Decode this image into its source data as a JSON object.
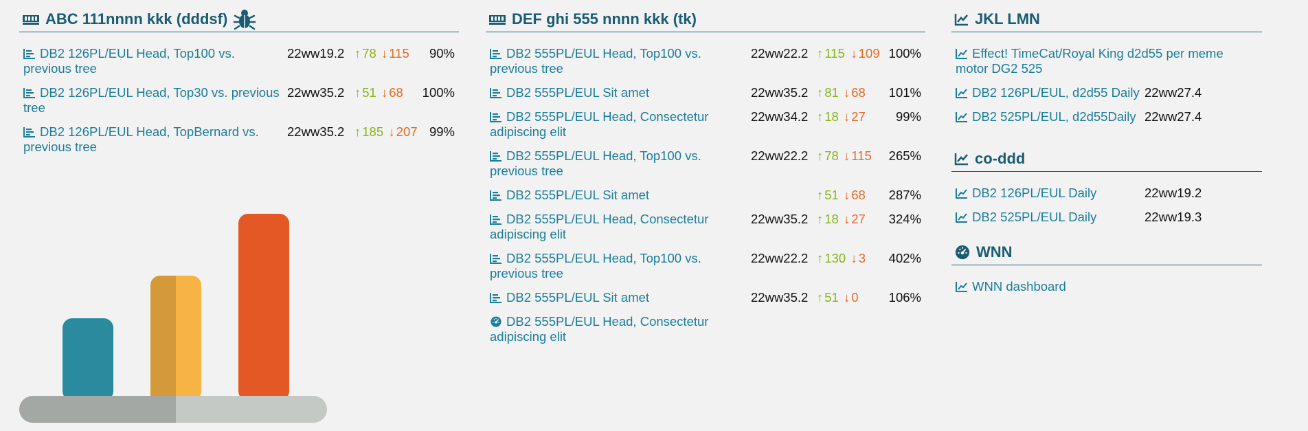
{
  "colors": {
    "accent": "#1a5c72",
    "link": "#1a7d9a",
    "up": "#8ab21b",
    "down": "#e46b24",
    "bar_teal": "#2a8b9e",
    "bar_yellow": "#f7b343",
    "bar_yellow_shade": "#d49a39",
    "bar_orange": "#e45826",
    "base_dark": "#a3a8a4",
    "base_light": "#c5c9c5"
  },
  "sections": {
    "abc": {
      "title": "ABC 111nnnn kkk (dddsf)",
      "icon": "memory-icon",
      "badge_icon": "bug-icon",
      "rows": [
        {
          "label": "DB2 126PL/EUL Head, Top100 vs. previous tree",
          "build": "22ww19.2",
          "up": "78",
          "down": "115",
          "pct": "90%"
        },
        {
          "label": "DB2 126PL/EUL Head, Top30 vs. previous tree",
          "build": "22ww35.2",
          "up": "51",
          "down": "68",
          "pct": "100%"
        },
        {
          "label": "DB2 126PL/EUL Head, TopBernard vs. previous tree",
          "build": "22ww35.2",
          "up": "185",
          "down": "207",
          "pct": "99%"
        }
      ]
    },
    "def": {
      "title": "DEF ghi 555 nnnn kkk (tk)",
      "icon": "memory-icon",
      "rows": [
        {
          "label": "DB2 555PL/EUL Head, Top100 vs. previous tree",
          "build": "22ww22.2",
          "up": "115",
          "down": "109",
          "pct": "100%"
        },
        {
          "label": "DB2 555PL/EUL Sit amet",
          "build": "22ww35.2",
          "up": "81",
          "down": "68",
          "pct": "101%"
        },
        {
          "label": "DB2 555PL/EUL Head, Consectetur adipiscing elit",
          "build": "22ww34.2",
          "up": "18",
          "down": "27",
          "pct": "99%"
        },
        {
          "label": "DB2 555PL/EUL Head, Top100 vs. previous tree",
          "build": "22ww22.2",
          "up": "78",
          "down": "115",
          "pct": "265%"
        },
        {
          "label": "DB2 555PL/EUL Sit amet",
          "build": "",
          "up": "51",
          "down": "68",
          "pct": "287%"
        },
        {
          "label": "DB2 555PL/EUL Head, Consectetur adipiscing elit",
          "build": "22ww35.2",
          "up": "18",
          "down": "27",
          "pct": "324%"
        },
        {
          "label": "DB2 555PL/EUL Head, Top100 vs. previous tree",
          "build": "22ww22.2",
          "up": "130",
          "down": "3",
          "pct": "402%"
        },
        {
          "label": "DB2 555PL/EUL Sit amet",
          "build": "22ww35.2",
          "up": "51",
          "down": "0",
          "pct": "106%"
        },
        {
          "label": "DB2 555PL/EUL Head, Consectetur adipiscing elit",
          "build": "",
          "up": "",
          "down": "",
          "pct": "",
          "icon": "dashboard-icon"
        }
      ]
    },
    "jkl": {
      "title": "JKL LMN",
      "icon": "line-chart-icon",
      "rows": [
        {
          "label": "Effect! TimeCat/Royal King d2d55 per meme motor DG2 525",
          "build": ""
        },
        {
          "label": "DB2 126PL/EUL, d2d55 Daily",
          "build": "22ww27.4"
        },
        {
          "label": "DB2 525PL/EUL, d2d55Daily",
          "build": "22ww27.4"
        }
      ]
    },
    "co": {
      "title": "co-ddd",
      "icon": "line-chart-icon",
      "rows": [
        {
          "label": "DB2 126PL/EUL Daily",
          "build": "22ww19.2"
        },
        {
          "label": "DB2 525PL/EUL Daily",
          "build": "22ww19.3"
        }
      ]
    },
    "wnn": {
      "title": "WNN",
      "icon": "dashboard-icon",
      "rows": [
        {
          "label": "WNN dashboard",
          "build": ""
        }
      ]
    }
  }
}
